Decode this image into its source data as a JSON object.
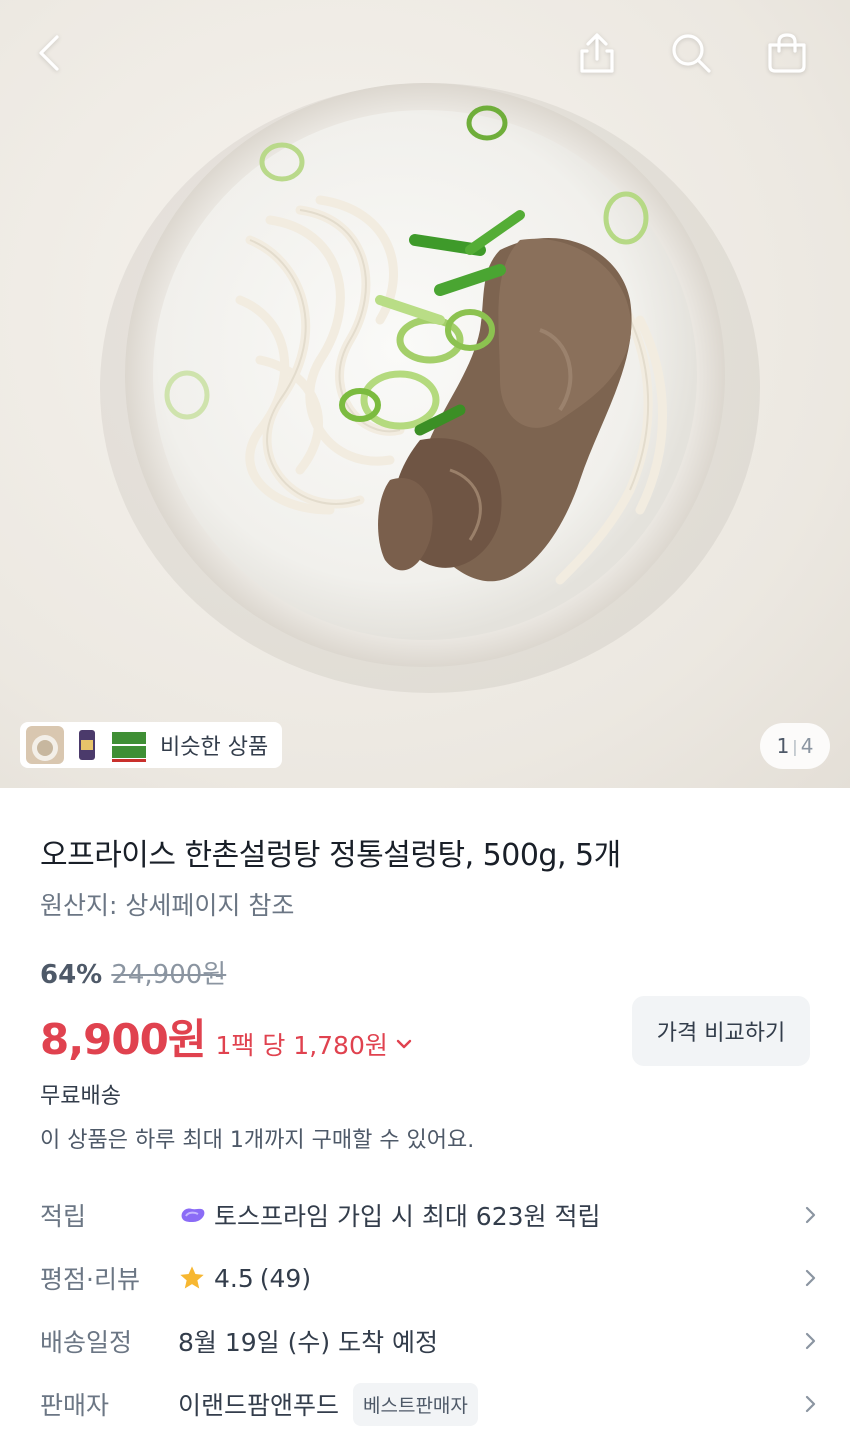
{
  "header": {
    "back_icon": "chevron-left-icon",
    "share_icon": "share-icon",
    "search_icon": "search-icon",
    "cart_icon": "shopping-bag-icon"
  },
  "gallery": {
    "similar_label": "비슷한 상품",
    "current_page": "1",
    "page_separator": "|",
    "total_pages": "4"
  },
  "product": {
    "title": "오프라이스 한촌설렁탕 정통설렁탕, 500g, 5개",
    "origin": "원산지: 상세페이지 참조",
    "discount_rate": "64%",
    "original_price": "24,900원",
    "price": "8,900원",
    "unit_price": "1팩 당 1,780원",
    "compare_button": "가격 비교하기",
    "shipping": "무료배송",
    "purchase_limit": "이 상품은 하루 최대 1개까지 구매할 수 있어요."
  },
  "details": {
    "points": {
      "label": "적립",
      "value": "토스프라임 가입 시 최대 623원 적립"
    },
    "rating": {
      "label": "평점·리뷰",
      "score": "4.5",
      "count": "(49)"
    },
    "delivery": {
      "label": "배송일정",
      "value": "8월 19일 (수) 도착 예정"
    },
    "seller": {
      "label": "판매자",
      "name": "이랜드팜앤푸드",
      "badge": "베스트판매자"
    }
  },
  "colors": {
    "price_red": "#e0424f",
    "star": "#f7b731",
    "prime_purple": "#8b6cf6"
  }
}
